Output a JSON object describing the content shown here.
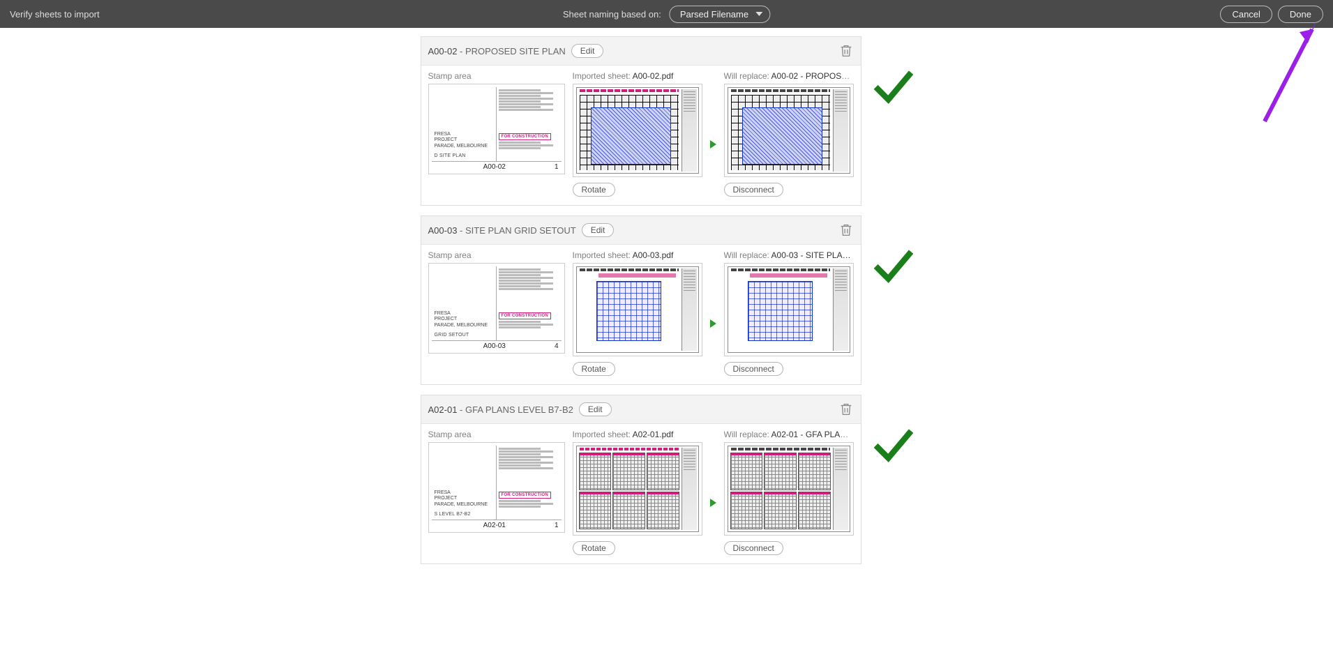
{
  "header": {
    "title": "Verify sheets to import",
    "naming_label": "Sheet naming based on:",
    "naming_value": "Parsed Filename",
    "cancel": "Cancel",
    "done": "Done"
  },
  "labels": {
    "edit": "Edit",
    "stamp_area": "Stamp area",
    "imported_sheet": "Imported sheet:",
    "will_replace": "Will replace:",
    "rotate": "Rotate",
    "disconnect": "Disconnect",
    "for_construction": "FOR CONSTRUCTION",
    "project_line1": "FRESA",
    "project_line2": "PROJECT",
    "project_line3": "PARADE, MELBOURNE"
  },
  "sheets": [
    {
      "number": "A00-02",
      "title": "PROPOSED SITE PLAN",
      "imported_file": "A00-02.pdf",
      "replace_text": "A00-02 - PROPOSE…",
      "stamp_plan_label": "D SITE PLAN",
      "stamp_page": "1",
      "plan_variant": "plan-a0002"
    },
    {
      "number": "A00-03",
      "title": "SITE PLAN GRID SETOUT",
      "imported_file": "A00-03.pdf",
      "replace_text": "A00-03 - SITE PLA…",
      "stamp_plan_label": "GRID SETOUT",
      "stamp_page": "4",
      "plan_variant": "plan-a0003"
    },
    {
      "number": "A02-01",
      "title": "GFA PLANS LEVEL B7-B2",
      "imported_file": "A02-01.pdf",
      "replace_text": "A02-01 - GFA PLAN…",
      "stamp_plan_label": "S LEVEL B7-B2",
      "stamp_page": "1",
      "plan_variant": "plan-a0201"
    }
  ]
}
